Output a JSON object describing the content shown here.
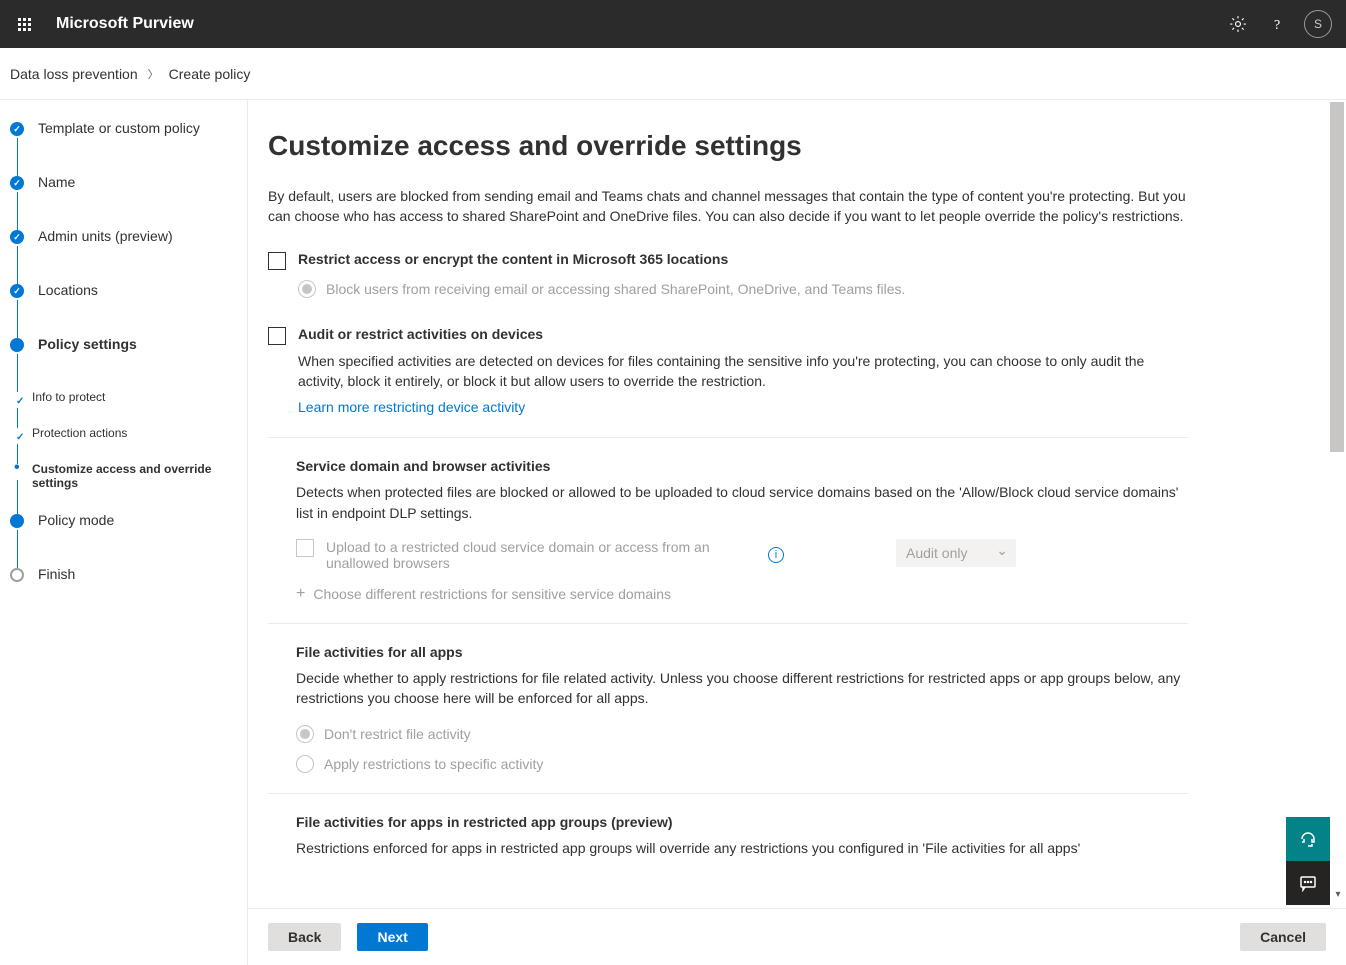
{
  "header": {
    "app_title": "Microsoft Purview",
    "avatar_initial": "S"
  },
  "breadcrumb": {
    "parent": "Data loss prevention",
    "current": "Create policy"
  },
  "wizard": {
    "steps": [
      {
        "label": "Template or custom policy",
        "state": "completed"
      },
      {
        "label": "Name",
        "state": "completed"
      },
      {
        "label": "Admin units (preview)",
        "state": "completed"
      },
      {
        "label": "Locations",
        "state": "completed"
      },
      {
        "label": "Policy settings",
        "state": "active"
      },
      {
        "label": "Info to protect",
        "state": "sub"
      },
      {
        "label": "Protection actions",
        "state": "sub"
      },
      {
        "label": "Customize access and override settings",
        "state": "sub-current"
      },
      {
        "label": "Policy mode",
        "state": "active-dot"
      },
      {
        "label": "Finish",
        "state": "pending"
      }
    ]
  },
  "page": {
    "title": "Customize access and override settings",
    "intro": "By default, users are blocked from sending email and Teams chats and channel messages that contain the type of content you're protecting. But you can choose who has access to shared SharePoint and OneDrive files. You can also decide if you want to let people override the policy's restrictions.",
    "opt1": {
      "label": "Restrict access or encrypt the content in Microsoft 365 locations",
      "sub_radio": "Block users from receiving email or accessing shared SharePoint, OneDrive, and Teams files."
    },
    "opt2": {
      "label": "Audit or restrict activities on devices",
      "desc": "When specified activities are detected on devices for files containing the sensitive info you're protecting, you can choose to only audit the activity, block it entirely, or block it but allow users to override the restriction.",
      "link": "Learn more restricting device activity"
    },
    "sect_domain": {
      "heading": "Service domain and browser activities",
      "desc": "Detects when protected files are blocked or allowed to be uploaded to cloud service domains based on the 'Allow/Block cloud service domains' list in endpoint DLP settings.",
      "chk_label": "Upload to a restricted cloud service domain or access from an unallowed browsers",
      "dropdown": "Audit only",
      "add_link": "Choose different restrictions for sensitive service domains"
    },
    "sect_files": {
      "heading": "File activities for all apps",
      "desc": "Decide whether to apply restrictions for file related activity. Unless you choose different restrictions for restricted apps or app groups below, any restrictions you choose here will be enforced for all apps.",
      "radio1": "Don't restrict file activity",
      "radio2": "Apply restrictions to specific activity"
    },
    "sect_restricted": {
      "heading": "File activities for apps in restricted app groups (preview)",
      "desc": "Restrictions enforced for apps in restricted app groups will override any restrictions you configured in 'File activities for all apps'"
    }
  },
  "footer": {
    "back": "Back",
    "next": "Next",
    "cancel": "Cancel"
  }
}
